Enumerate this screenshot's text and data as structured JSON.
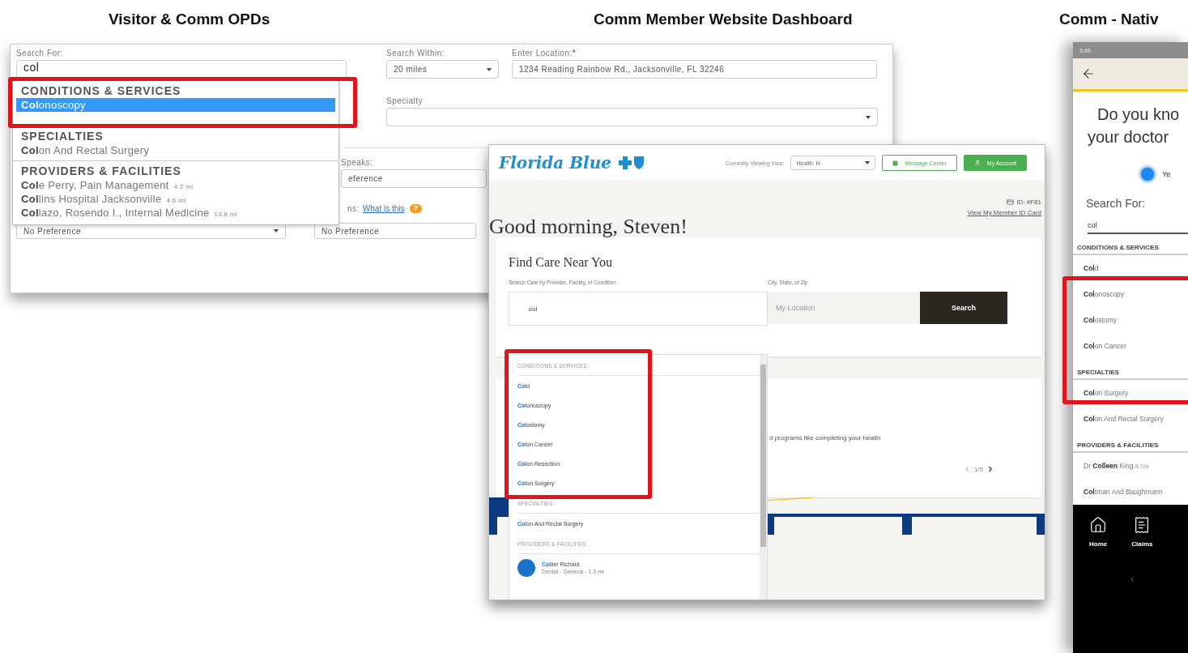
{
  "visitor_opd": {
    "title": "Visitor & Comm OPDs",
    "search": {
      "label": "Search For:",
      "value": "col"
    },
    "suggestions": [
      {
        "heading": "CONDITIONS & SERVICES",
        "items": [
          {
            "text": "**Col**onoscopy",
            "selected": true
          }
        ]
      },
      {
        "heading": "SPECIALTIES",
        "items": [
          {
            "text": "**Col**on And Rectal Surgery",
            "selected": false
          }
        ]
      },
      {
        "heading": "PROVIDERS & FACILITIES",
        "items": [
          {
            "text": "**Col**e Perry, Pain Management",
            "distance": "4.2 mi",
            "selected": false
          },
          {
            "text": "**Col**lins Hospital Jacksonville",
            "distance": "4.6 mi",
            "selected": false
          },
          {
            "text": "**Col**lazo, Rosendo I., Internal Medicine",
            "distance": "13.8 mi",
            "selected": false
          }
        ]
      }
    ],
    "search_within": {
      "label": "Search Within:",
      "value": "20 miles"
    },
    "location": {
      "label": "Enter Location:",
      "required_mark": "*",
      "value": "1234 Reading Rainbow Rd., Jacksonville, FL 32246"
    },
    "specialty": {
      "label": "Specialty"
    },
    "speaks": {
      "label": "Speaks:",
      "value": "eference"
    },
    "help": {
      "label": "ns:",
      "link": "What is this",
      "badge": "?"
    },
    "preferences": [
      "No Preference",
      "No Preference"
    ]
  },
  "dashboard": {
    "title": "Comm Member Website Dashboard",
    "logo": "Florida Blue",
    "viewing_label": "Currently Viewing Your:",
    "plan": "Health: H",
    "buttons": [
      {
        "label": "Message Center",
        "kind": "outline"
      },
      {
        "label": "My Account",
        "kind": "solid"
      }
    ],
    "greeting": "Good morning, Steven!",
    "member_id": "ID: #F81",
    "id_card_link": "View My Member ID Card",
    "find_care": {
      "title": "Find Care Near You",
      "search_label": "Search Care by Provider, Facility, or Condition",
      "search_value": "col",
      "location_label": "City, State, or Zip",
      "location_placeholder": "My Location",
      "button": "Search"
    },
    "suggestions": [
      {
        "heading": "CONDITIONS & SERVICES",
        "items": [
          {
            "text": "**Col**d"
          },
          {
            "text": "**Col**onoscopy"
          },
          {
            "text": "**Col**ostomy"
          },
          {
            "text": "**Col**on Cancer"
          },
          {
            "text": "**Col**on Resection"
          },
          {
            "text": "**Col**on Surgery"
          }
        ]
      },
      {
        "heading": "SPECIALTIES",
        "items": [
          {
            "text": "**Col**on And Rectal Surgery"
          }
        ]
      },
      {
        "heading": "PROVIDERS & FACILITIES",
        "items": [
          {
            "text": "**Col**lier Richard",
            "detail": "Dental - General - 1.0 mi"
          }
        ]
      }
    ],
    "promo_text": "d programs like completing your health",
    "pager": "1/5"
  },
  "mobile_app": {
    "title": "Comm - Nativ",
    "time": "3:45",
    "question_lines": [
      "Do you kno",
      "your doctor"
    ],
    "answer": {
      "label": "Ye",
      "selected": true
    },
    "search_label": "Search For:",
    "search_value": "col",
    "suggestions": [
      {
        "heading": "CONDITIONS & SERVICES",
        "items": [
          {
            "text": "**Col**d"
          },
          {
            "text": "**Col**onoscopy"
          },
          {
            "text": "**Col**ostomy"
          },
          {
            "text": "**Col**on Cancer"
          }
        ]
      },
      {
        "heading": "SPECIALTIES",
        "items": [
          {
            "text": "**Col**on Surgery"
          },
          {
            "text": "**Col**on And Rectal Surgery"
          }
        ]
      },
      {
        "heading": "PROVIDERS & FACILITIES",
        "items": [
          {
            "text": "Dr **Colleen** King",
            "distance": "8.7mi"
          },
          {
            "text": "**Col**tman And Baughmann"
          }
        ]
      }
    ],
    "nav": [
      {
        "label": "Home",
        "kind": "home"
      },
      {
        "label": "Claims",
        "kind": "claims"
      }
    ]
  }
}
